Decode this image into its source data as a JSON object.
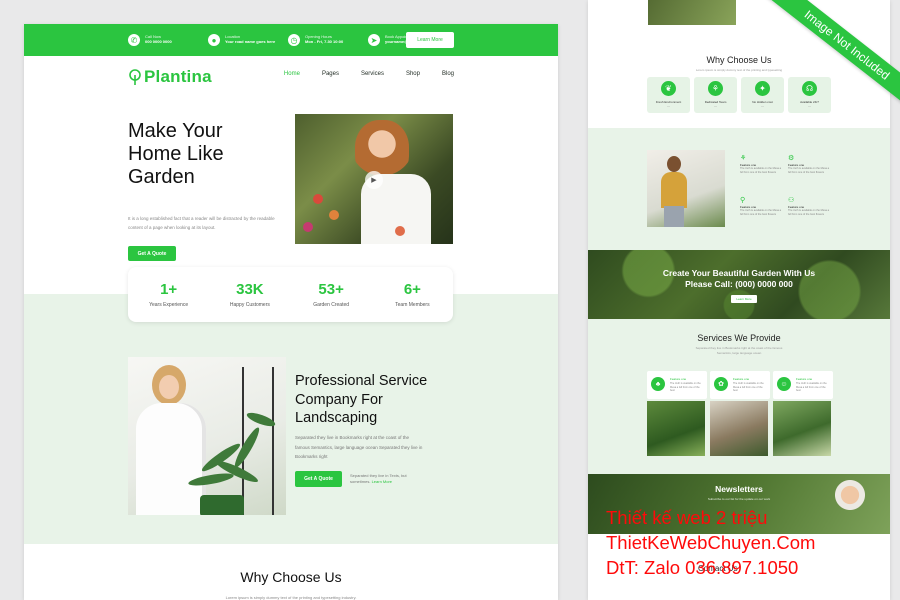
{
  "topbar": {
    "items": [
      {
        "icon": "phone-icon",
        "label": "Call Now",
        "value": "000 0000 0000"
      },
      {
        "icon": "location-icon",
        "label": "Location",
        "value": "Your road name goes here"
      },
      {
        "icon": "clock-icon",
        "label": "Opening Hours",
        "value": "Mon - Fri, 7.30 10:00"
      },
      {
        "icon": "send-icon",
        "label": "Book Appointment",
        "value": "yourname@domain.com"
      }
    ],
    "button": "Learn More"
  },
  "nav": {
    "logo": "Plantina",
    "menu": [
      "Home",
      "Pages",
      "Services",
      "Shop",
      "Blog"
    ],
    "active": "Home"
  },
  "hero": {
    "title": "Make Your Home Like Garden",
    "text": "It is a long established fact that a reader will be distracted by the readable content of a page when looking at its layout.",
    "button": "Get A Quote"
  },
  "stats": [
    {
      "number": "1+",
      "label": "Years Experience"
    },
    {
      "number": "33K",
      "label": "Happy Customers"
    },
    {
      "number": "53+",
      "label": "Garden Created"
    },
    {
      "number": "6+",
      "label": "Team Members"
    }
  ],
  "about": {
    "title": "Professional Service Company For Landscaping",
    "text": "Separated they live in Bookmarks right at the coast of the famous Semantics, large language ocean Separated they live in Bookmarks right",
    "button": "Get A Quote",
    "note": "Separated they live in Texts, but sometimes.",
    "note_link": "Learn More"
  },
  "why_main": {
    "title": "Why Choose Us",
    "subtitle": "Lorem ipsum is simply dummy text of the printing and typesetting industry."
  },
  "side": {
    "why": {
      "title": "Why Choose Us",
      "subtitle": "Lorem ipsum is simply dummy text of the printing and typesetting",
      "cards": [
        {
          "icon": "leaf-icon",
          "label": "Fresh Environment"
        },
        {
          "icon": "team-icon",
          "label": "Dedicated Team"
        },
        {
          "icon": "bulb-icon",
          "label": "No Hidden cost"
        },
        {
          "icon": "headset-icon",
          "label": "Available 24/7"
        }
      ]
    },
    "features": [
      {
        "icon": "sprout-icon",
        "title": "Feature one",
        "text": "The truth is available on the Mesa a fell from one of the best flowers"
      },
      {
        "icon": "gear-icon",
        "title": "Feature one",
        "text": "The truth is available on the Mesa a fell from one of the best flowers"
      },
      {
        "icon": "watering-icon",
        "title": "Feature one",
        "text": "The truth is available on the Mesa a fell from one of the best flowers"
      },
      {
        "icon": "person-icon",
        "title": "Feature one",
        "text": "The truth is available on the Mesa a fell from one of the best flowers"
      }
    ],
    "cta": {
      "line1": "Create Your Beautiful Garden With Us",
      "line2": "Please Call: (000) 0000 000",
      "button": "Learn More"
    },
    "services": {
      "title": "Services We Provide",
      "subtitle": "Separated they live in Bookmarks right at the coast of the famous Semantics, large language ocean",
      "cards": [
        {
          "icon": "tree-icon",
          "title": "Feature one",
          "text": "The truth is available on the Mesa a fell from one of the best"
        },
        {
          "icon": "gardener-icon",
          "title": "Feature one",
          "text": "The truth is available on the Mesa a fell from one of the best"
        },
        {
          "icon": "worker-icon",
          "title": "Feature one",
          "text": "The truth is available on the Mesa a fell from one of the best"
        }
      ]
    },
    "newsletter": {
      "title": "Newsletters",
      "subtitle": "Subscribe to our list for the update on our work"
    },
    "footer_title": "Contact Us"
  },
  "ribbon": "Image Not Included",
  "watermark": {
    "line1": "Thiết kế web 2 triệu",
    "line2": "ThietKeWebChuyen.Com",
    "line3": "DtT: Zalo 036.897.1050"
  },
  "colors": {
    "brand": "#2bc540",
    "band": "#e8f3e8",
    "watermark": "#ff0a0a"
  }
}
